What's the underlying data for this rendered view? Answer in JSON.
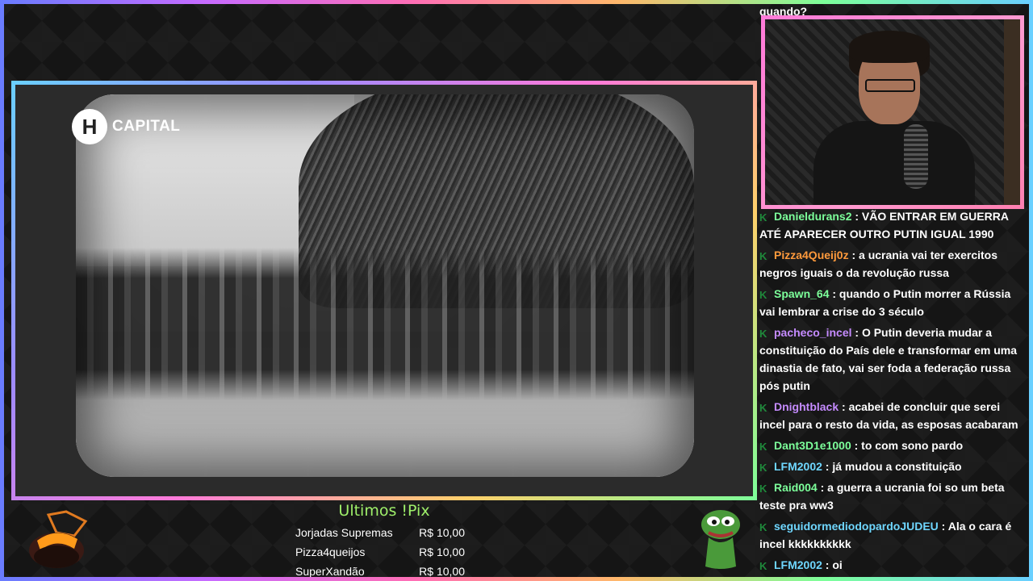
{
  "video": {
    "logo_mark": "H",
    "logo_text": "CAPITAL"
  },
  "chat": {
    "top_partial": "quando?",
    "messages": [
      {
        "user": "Danieldurans2",
        "color": "#7cff9a",
        "text": " : VÃO ENTRAR EM GUERRA ATÉ APARECER OUTRO PUTIN IGUAL 1990"
      },
      {
        "user": "Pizza4Queij0z",
        "color": "#ff9a3c",
        "text": " : a ucrania vai ter exercitos negros iguais o da revolução russa"
      },
      {
        "user": "Spawn_64",
        "color": "#7cff9a",
        "text": " : quando o Putin morrer a Rússia vai lembrar a crise do 3 século"
      },
      {
        "user": "pacheco_incel",
        "color": "#c58bff",
        "text": " : O Putin deveria mudar a constituição do País dele e transformar em uma dinastia de fato, vai ser foda a federação russa pós putin"
      },
      {
        "user": "Dnightblack",
        "color": "#c58bff",
        "text": " : acabei de concluir que serei incel para o resto da vida, as esposas acabaram"
      },
      {
        "user": "Dant3D1e1000",
        "color": "#7cff9a",
        "text": " : to com sono pardo"
      },
      {
        "user": "LFM2002",
        "color": "#6fd7ff",
        "text": " : já mudou a constituição"
      },
      {
        "user": "Raid004",
        "color": "#7cff9a",
        "text": " : a guerra a ucrania foi so um beta teste pra ww3"
      },
      {
        "user": "seguidormediodopardoJUDEU",
        "color": "#6fd7ff",
        "text": " : Ala o cara é incel kkkkkkkkkk"
      },
      {
        "user": "LFM2002",
        "color": "#6fd7ff",
        "text": " : oi"
      }
    ]
  },
  "pix": {
    "title": "Ultimos !Pix",
    "rows": [
      {
        "name": "Jorjadas Supremas",
        "amount": "R$ 10,00"
      },
      {
        "name": "Pizza4queijos",
        "amount": "R$ 10,00"
      },
      {
        "name": "SuperXandão",
        "amount": "R$ 10,00"
      }
    ]
  },
  "colors": {
    "badge": "#1f8a3b",
    "pix_title": "#9ff06a"
  }
}
